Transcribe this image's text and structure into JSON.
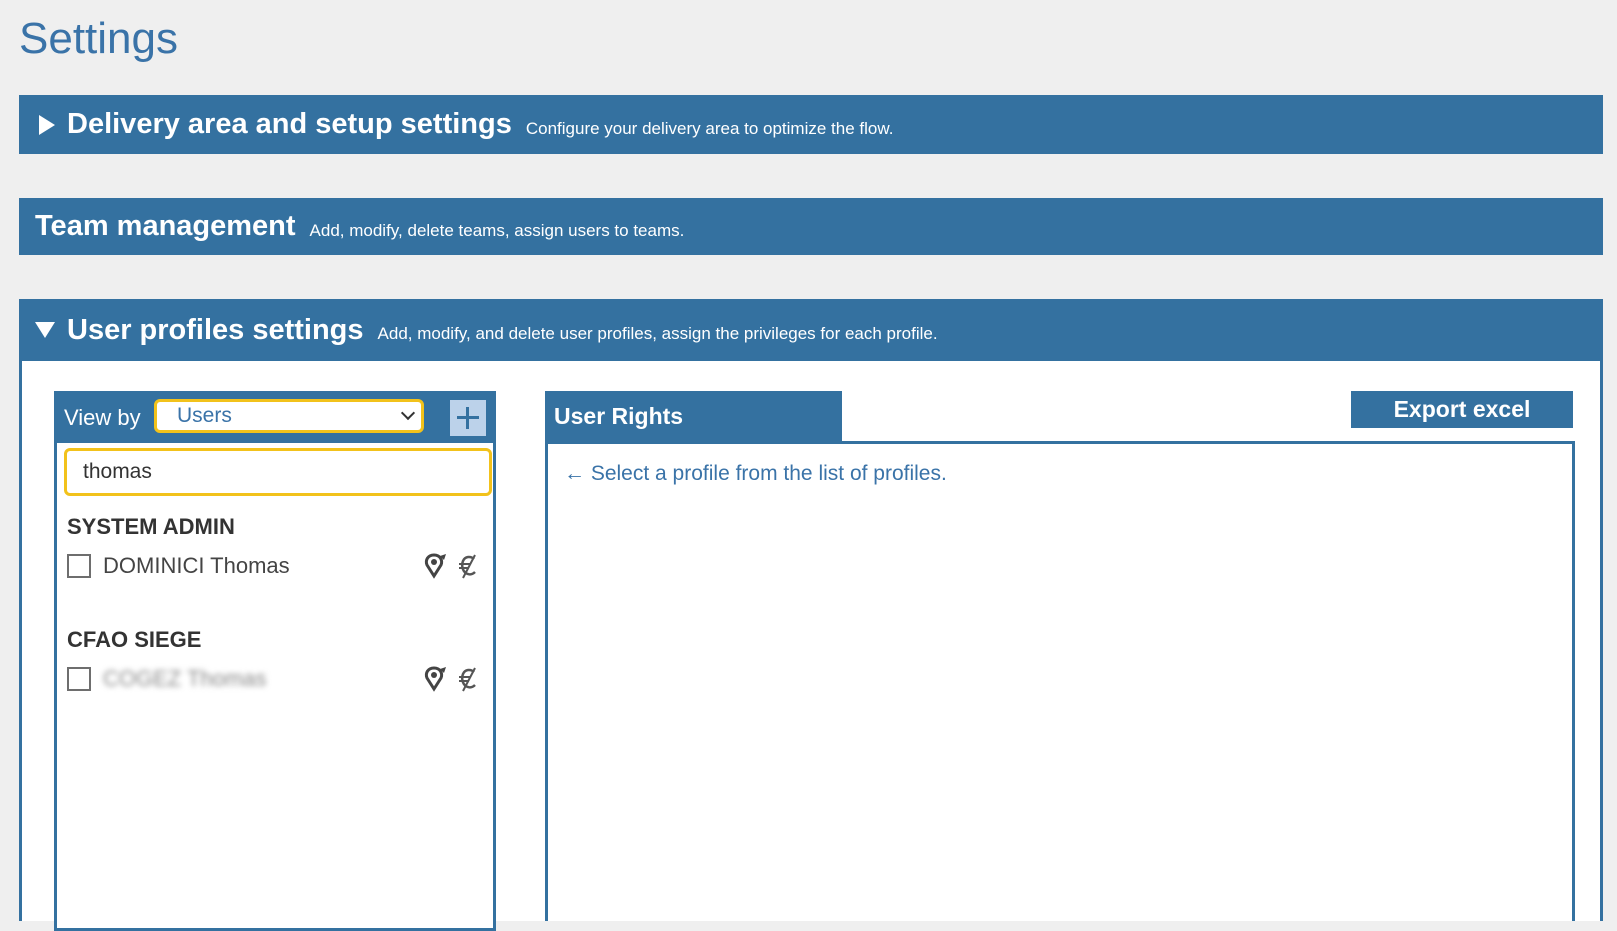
{
  "page": {
    "title": "Settings"
  },
  "sections": {
    "delivery": {
      "title": "Delivery area and setup settings",
      "description": "Configure your delivery area to optimize the flow."
    },
    "team": {
      "title": "Team management",
      "description": "Add, modify, delete teams, assign users to teams."
    },
    "user_profiles": {
      "title": "User profiles settings",
      "description": "Add, modify, and delete user profiles, assign the privileges for each profile."
    }
  },
  "list_panel": {
    "view_by_label": "View by",
    "view_by_value": "Users",
    "search_value": "thomas",
    "groups": [
      {
        "title": "SYSTEM ADMIN",
        "users": [
          "DOMINICI Thomas"
        ]
      },
      {
        "title": "CFAO SIEGE",
        "users": [
          "COGEZ Thomas"
        ]
      }
    ]
  },
  "rights_panel": {
    "tab_label": "User Rights",
    "export_label": "Export excel",
    "hint": "← Select a profile from the list of profiles."
  },
  "colors": {
    "accent": "#3471a0",
    "highlight": "#f2c21b",
    "title_text": "#3a73a8",
    "background": "#efefef"
  },
  "icons": {
    "row_icon_1": "location-pin-icon",
    "row_icon_2": "no-euro-icon",
    "add": "plus-icon",
    "dropdown": "chevron-down-icon"
  }
}
